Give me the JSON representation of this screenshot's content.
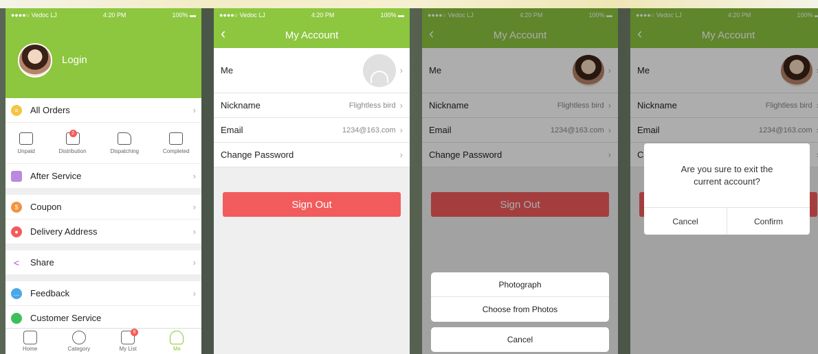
{
  "colors": {
    "accent": "#8dc63f",
    "danger": "#f25c5c"
  },
  "status": {
    "carrier": "●●●●○ Vedoc LJ",
    "time": "4:20 PM",
    "battery": "100%"
  },
  "screen1": {
    "login": "Login",
    "all_orders": "All Orders",
    "order_states": [
      {
        "label": "Unpaid",
        "icon": "wallet-icon"
      },
      {
        "label": "Distribution",
        "icon": "box-icon",
        "badge": "2"
      },
      {
        "label": "Dispatching",
        "icon": "truck-icon"
      },
      {
        "label": "Completed",
        "icon": "check-icon"
      }
    ],
    "after_service": "After Service",
    "coupon": "Coupon",
    "delivery_address": "Delivery Address",
    "share": "Share",
    "feedback": "Feedback",
    "customer_service": "Customer Service",
    "tabs": [
      {
        "label": "Home",
        "icon": "home-icon"
      },
      {
        "label": "Category",
        "icon": "category-icon"
      },
      {
        "label": "My List",
        "icon": "cart-icon",
        "badge": "6"
      },
      {
        "label": "Me",
        "icon": "person-icon"
      }
    ]
  },
  "account": {
    "title": "My Account",
    "me": "Me",
    "nickname_label": "Nickname",
    "nickname_value": "Flightless bird",
    "email_label": "Email",
    "email_value": "1234@163.com",
    "change_password": "Change Password",
    "sign_out": "Sign Out"
  },
  "photo_sheet": {
    "photograph": "Photograph",
    "choose": "Choose from Photos",
    "cancel": "Cancel"
  },
  "dialog": {
    "message": "Are you sure to exit the current account?",
    "cancel": "Cancel",
    "confirm": "Confirm"
  }
}
